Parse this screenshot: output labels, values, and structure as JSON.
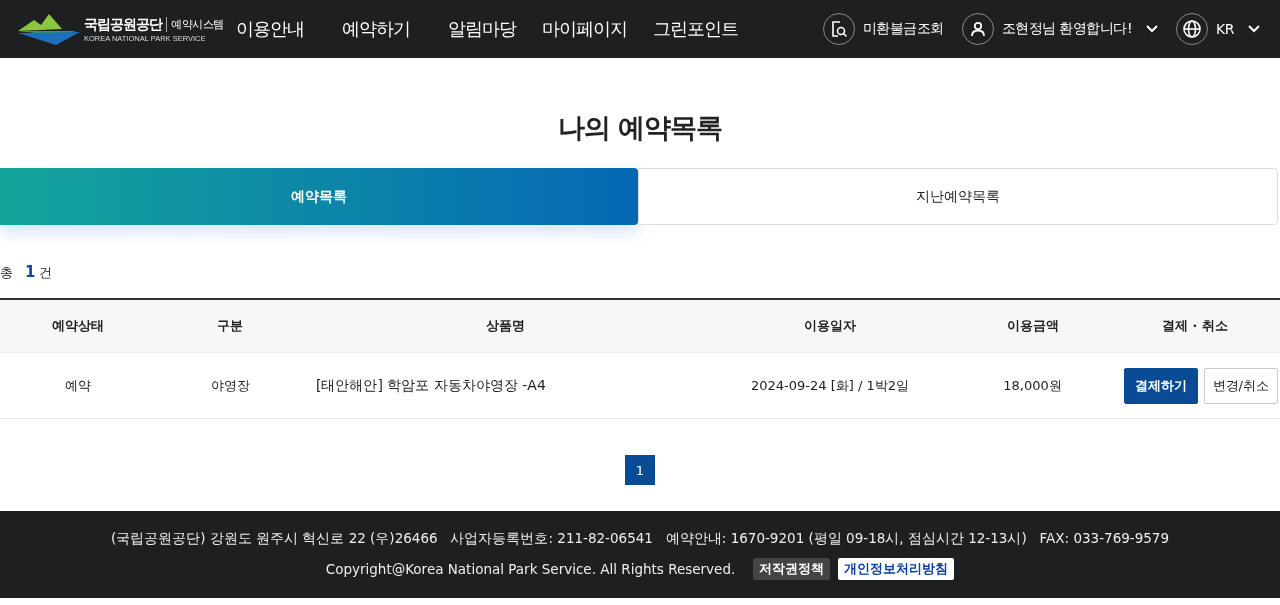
{
  "header": {
    "logo": {
      "name": "국립공원공단",
      "system": "예약시스템",
      "english": "KOREA NATIONAL PARK SERVICE"
    },
    "nav": [
      "이용안내",
      "예약하기",
      "알림마당",
      "마이페이지",
      "그린포인트"
    ],
    "utilities": [
      {
        "kind": "search",
        "label": "미환불금조회"
      },
      {
        "kind": "user",
        "label": "조현정님 환영합니다!"
      },
      {
        "kind": "language",
        "label": "KR"
      }
    ]
  },
  "page_title": "나의 예약목록",
  "tabs": [
    {
      "label": "예약목록",
      "selected": true
    },
    {
      "label": "지난예약목록",
      "selected": false
    }
  ],
  "count": {
    "prefix": "총",
    "value": "1",
    "suffix": "건"
  },
  "table": {
    "columns": [
      "예약상태",
      "구분",
      "상품명",
      "이용일자",
      "이용금액",
      "결제 · 취소"
    ],
    "rows": [
      {
        "status": "예약",
        "category": "야영장",
        "product": "[태안해안] 학암포 자동차야영장 -A4",
        "date": "2024-09-24 [화] / 1박2일",
        "amount": "18,000원",
        "actions": [
          {
            "label": "결제하기",
            "primary": true
          },
          {
            "label": "변경/취소",
            "primary": false
          }
        ]
      }
    ]
  },
  "pagination": [
    {
      "label": "1",
      "selected": true
    }
  ],
  "footer": {
    "address": "(국립공원공단) 강원도 원주시 혁신로 22 (우)26466   사업자등록번호: 211-82-06541   예약안내: 1670-9201 (평일 09-18시, 점심시간 12-13시)   FAX: 033-769-9579",
    "copyright": "Copyright@Korea National Park Service. All Rights Reserved.",
    "links": [
      {
        "label": "저작권정책",
        "highlight": false
      },
      {
        "label": "개인정보처리방침",
        "highlight": true
      }
    ]
  }
}
